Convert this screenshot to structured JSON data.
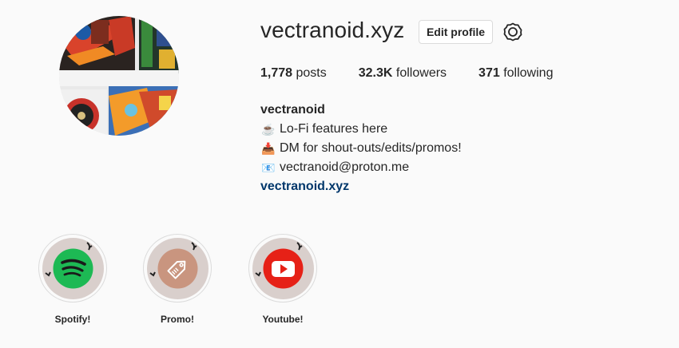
{
  "profile": {
    "username": "vectranoid.xyz",
    "edit_label": "Edit profile",
    "stats": [
      {
        "value": "1,778",
        "label": "posts"
      },
      {
        "value": "32.3K",
        "label": "followers"
      },
      {
        "value": "371",
        "label": "following"
      }
    ],
    "bio": {
      "name": "vectranoid",
      "lines": [
        {
          "icon": "coffee-emoji",
          "glyph": "☕",
          "text": "Lo-Fi features here"
        },
        {
          "icon": "inbox-tray-emoji",
          "glyph": "📥",
          "text": "DM for shout-outs/edits/promos!"
        },
        {
          "icon": "envelope-emoji",
          "glyph": "📧",
          "text": "vectranoid@proton.me"
        }
      ],
      "link": "vectranoid.xyz"
    }
  },
  "highlights": [
    {
      "label": "Spotify!",
      "icon": "spotify-icon",
      "color": "#1db954"
    },
    {
      "label": "Promo!",
      "icon": "tag-icon",
      "color": "#c9957f"
    },
    {
      "label": "Youtube!",
      "icon": "youtube-icon",
      "color": "#e62117"
    }
  ],
  "colors": {
    "link": "#00376b",
    "text": "#262626",
    "border": "#dbdbdb"
  }
}
